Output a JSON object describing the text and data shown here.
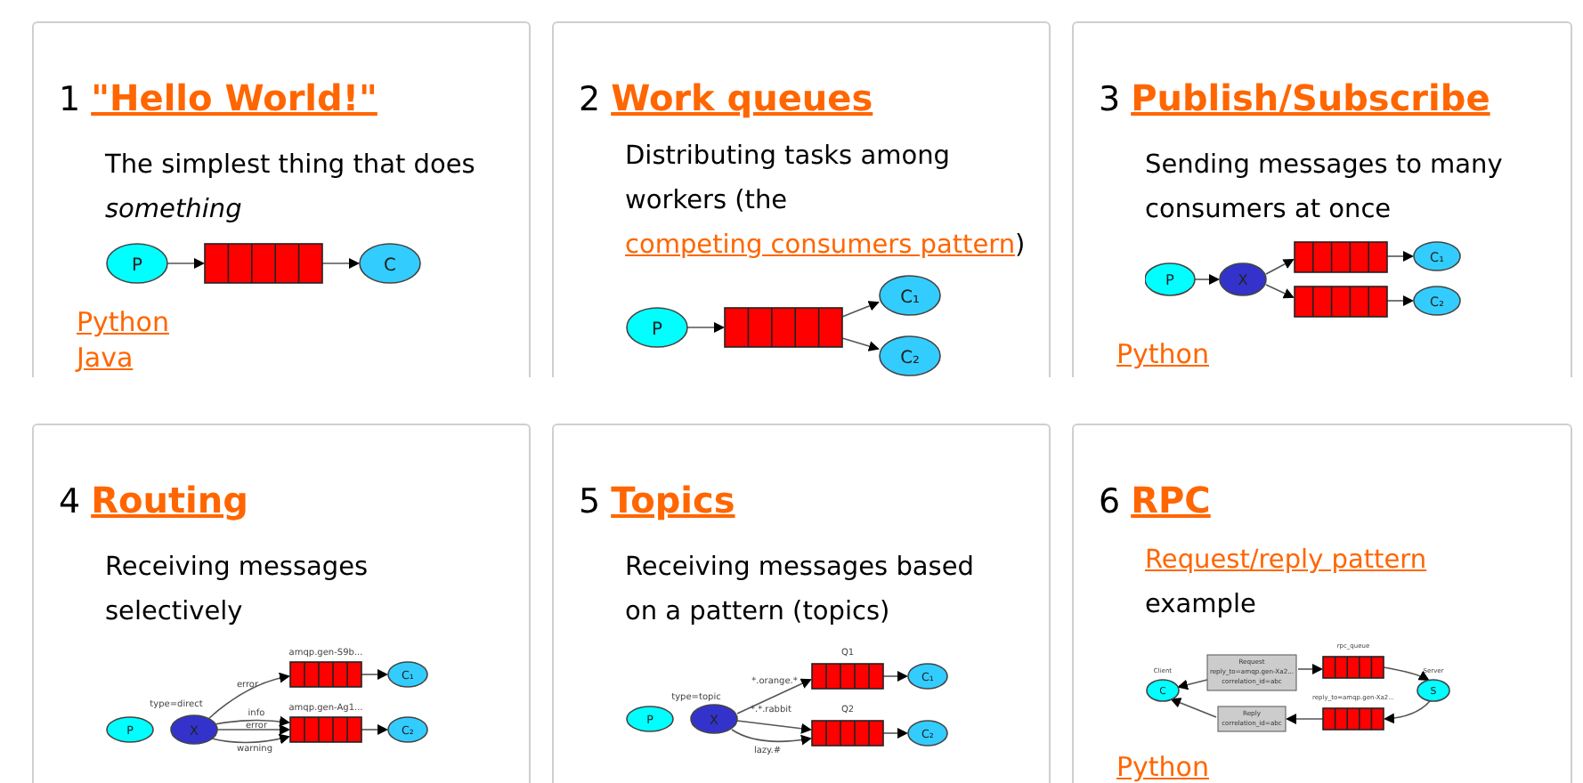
{
  "cards": [
    {
      "number": "1",
      "title": "\"Hello World!\"",
      "description": [
        {
          "text": "The simplest thing that does *something*"
        }
      ],
      "diagram": {
        "kind": "hello",
        "labels": [
          "P",
          "C"
        ]
      },
      "links": [
        "Python",
        "Java"
      ]
    },
    {
      "number": "2",
      "title": "Work queues",
      "description": [
        {
          "text": "Distributing tasks among workers (the "
        },
        {
          "text": "competing consumers pattern",
          "link": true
        },
        {
          "text": ")"
        }
      ],
      "diagram": {
        "kind": "workqueue",
        "labels": [
          "P",
          "C₁",
          "C₂"
        ]
      }
    },
    {
      "number": "3",
      "title": "Publish/Subscribe",
      "description": [
        {
          "text": "Sending messages to many consumers at once"
        }
      ],
      "diagram": {
        "kind": "pubsub",
        "labels": [
          "P",
          "X",
          "C₁",
          "C₂"
        ]
      },
      "links": [
        "Python"
      ]
    },
    {
      "number": "4",
      "title": "Routing",
      "description": [
        {
          "text": "Receiving messages selectively"
        }
      ],
      "diagram": {
        "kind": "routing",
        "labels": [
          "P",
          "X",
          "C₁",
          "C₂",
          "amqp.gen-S9b...",
          "amqp.gen-Ag1...",
          "type=direct",
          "error",
          "info",
          "error",
          "warning"
        ]
      }
    },
    {
      "number": "5",
      "title": "Topics",
      "description": [
        {
          "text": "Receiving messages based on a pattern (topics)"
        }
      ],
      "diagram": {
        "kind": "topics",
        "labels": [
          "P",
          "X",
          "C₁",
          "C₂",
          "Q1",
          "Q2",
          "type=topic",
          "*.orange.*",
          "*.*.rabbit",
          "lazy.#"
        ]
      }
    },
    {
      "number": "6",
      "title": "RPC",
      "description": [
        {
          "text": "Request/reply pattern",
          "link": true
        },
        {
          "text": " example"
        }
      ],
      "diagram": {
        "kind": "rpc",
        "labels": [
          "C",
          "S",
          "Client",
          "Server",
          "rpc_queue",
          "reply_to=amqp.gen-Xa2...",
          "Request",
          "reply_to=amqp.gen-Xa2...",
          "correlation_id=abc",
          "Reply",
          "correlation_id=abc"
        ]
      },
      "links": [
        "Python"
      ]
    }
  ]
}
